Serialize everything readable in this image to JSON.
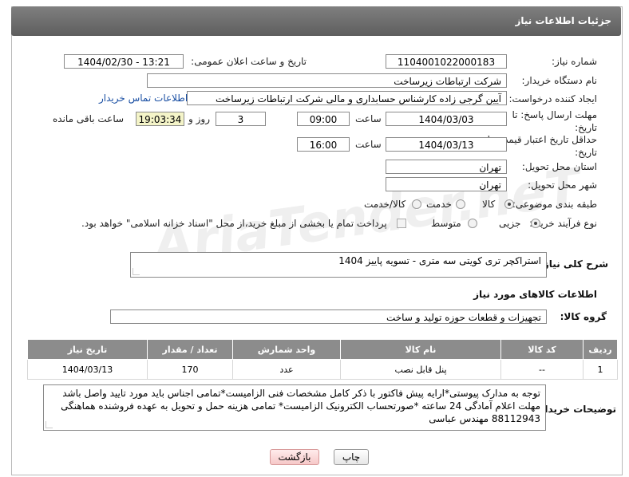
{
  "header": {
    "title": "جزئیات اطلاعات نیاز"
  },
  "fields": {
    "need_number_label": "شماره نیاز:",
    "need_number": "1104001022000183",
    "announce_label": "تاریخ و ساعت اعلان عمومی:",
    "announce_value": "1404/02/30 - 13:21",
    "buyer_org_label": "نام دستگاه خریدار:",
    "buyer_org": "شرکت ارتباطات زیرساخت",
    "requester_label": "ایجاد کننده درخواست:",
    "requester": "آیین گرجی زاده کارشناس حسابداری و مالی شرکت ارتباطات زیرساخت",
    "contact_link": "اطلاعات تماس خریدار",
    "reply_deadline_label": "مهلت ارسال پاسخ: تا تاریخ:",
    "reply_date": "1404/03/03",
    "time_label": "ساعت",
    "reply_time": "09:00",
    "days_value": "3",
    "days_label": "روز و",
    "remaining_value": "19:03:34",
    "remaining_label": "ساعت باقی مانده",
    "price_validity_label": "حداقل تاریخ اعتبار قیمت: تا تاریخ:",
    "price_date": "1404/03/13",
    "price_time": "16:00",
    "province_label": "استان محل تحویل:",
    "province": "تهران",
    "city_label": "شهر محل تحویل:",
    "city": "تهران",
    "category_label": "طبقه بندی موضوعی:",
    "category_options": [
      "کالا",
      "خدمت",
      "کالا/خدمت"
    ],
    "process_label": "نوع فرآیند خرید :",
    "process_options": [
      "جزیی",
      "متوسط"
    ],
    "payment_note": "پرداخت تمام یا بخشی از مبلغ خرید،از محل \"اسناد خزانه اسلامی\" خواهد بود."
  },
  "summary": {
    "label": "شرح کلی نیاز:",
    "value": "استراکچر تری کویتی سه متری -        تسویه پاییز 1404"
  },
  "goods": {
    "section_title": "اطلاعات کالاهای مورد نیاز",
    "group_label": "گروه کالا:",
    "group_value": "تجهیزات و قطعات حوزه تولید و ساخت",
    "columns": [
      "ردیف",
      "کد کالا",
      "نام کالا",
      "واحد شمارش",
      "تعداد / مقدار",
      "تاریخ نیاز"
    ],
    "rows": [
      {
        "row": "1",
        "code": "--",
        "name": "پنل قابل نصب",
        "unit": "عدد",
        "qty": "170",
        "date": "1404/03/13"
      }
    ]
  },
  "buyer_notes": {
    "label": "توضیحات خریدار:",
    "text": "توجه به مدارک پیوستی*ارایه پیش فاکتور با ذکر کامل مشخصات فنی الزامیست*تمامی اجناس باید مورد تایید واصل باشد مهلت اعلام آمادگی 24 ساعته *صورتحساب الکترونیک الزامیست* تمامی هزینه حمل و تحویل به عهده فروشنده هماهنگی 88112943 مهندس عباسی"
  },
  "buttons": {
    "print": "چاپ",
    "back": "بازگشت"
  },
  "watermark": "AriaTender.neT"
}
